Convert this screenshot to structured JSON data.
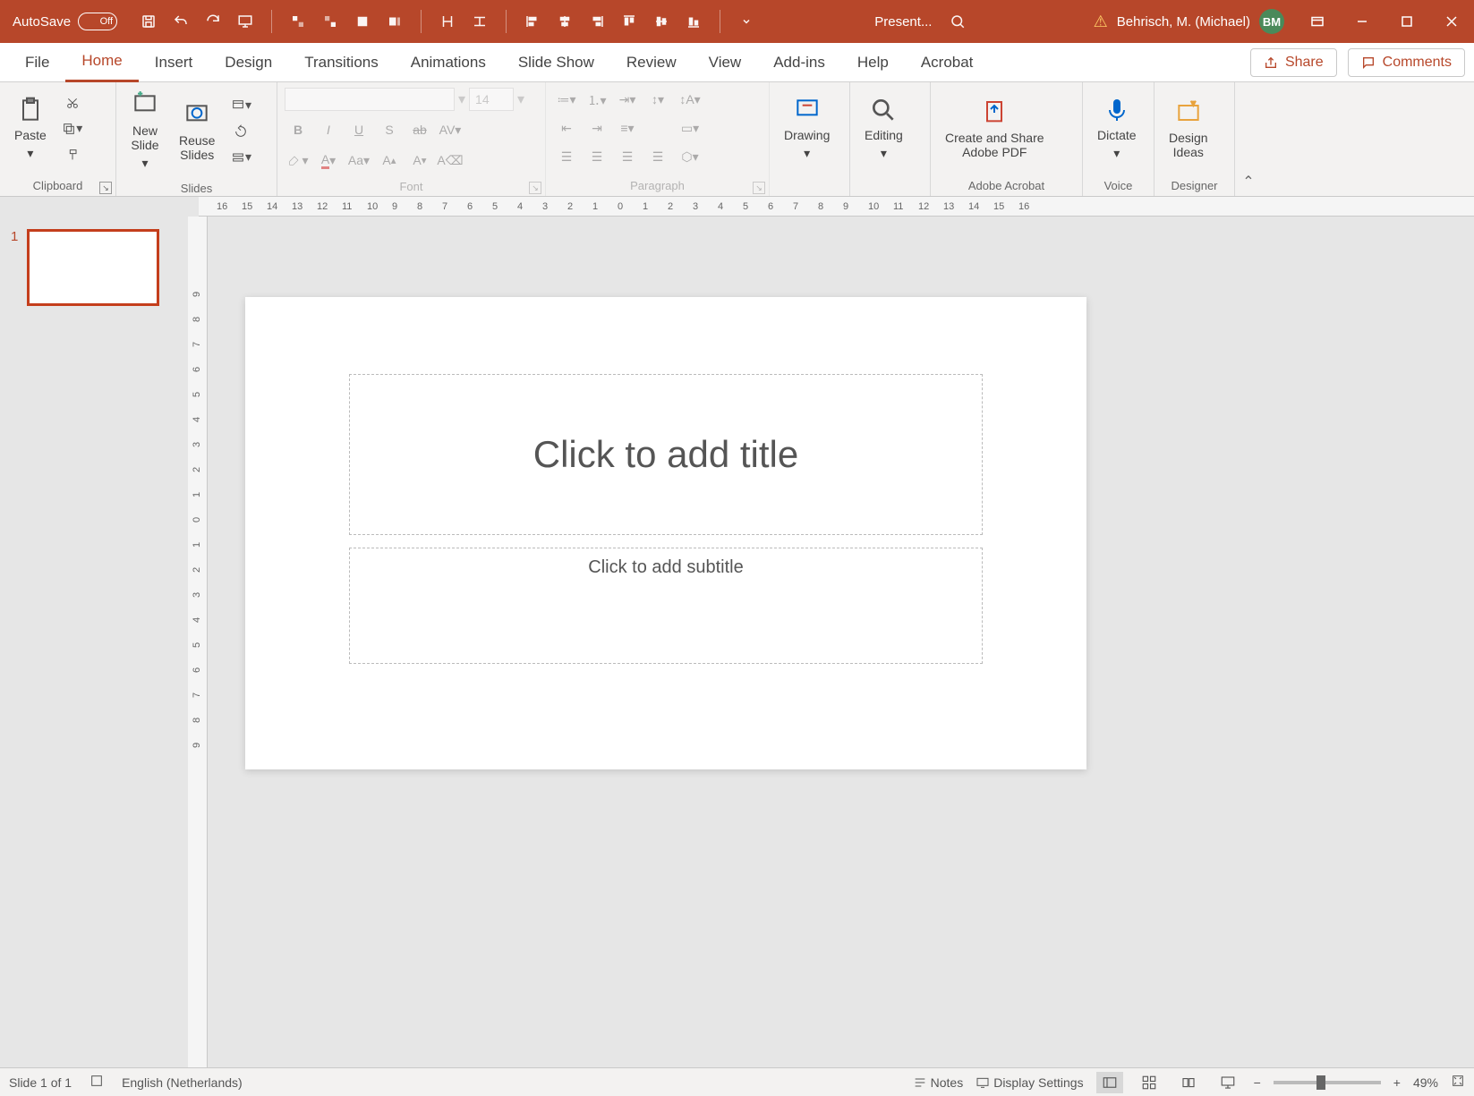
{
  "titlebar": {
    "autosave_label": "AutoSave",
    "autosave_state": "Off",
    "doc_title": "Present...",
    "user_name": "Behrisch, M. (Michael)",
    "user_initials": "BM"
  },
  "tabs": {
    "items": [
      "File",
      "Home",
      "Insert",
      "Design",
      "Transitions",
      "Animations",
      "Slide Show",
      "Review",
      "View",
      "Add-ins",
      "Help",
      "Acrobat"
    ],
    "active_index": 1,
    "share": "Share",
    "comments": "Comments"
  },
  "ribbon": {
    "clipboard": {
      "paste": "Paste",
      "label": "Clipboard"
    },
    "slides": {
      "new_slide": "New\nSlide",
      "reuse": "Reuse\nSlides",
      "label": "Slides"
    },
    "font": {
      "size": "14",
      "label": "Font"
    },
    "paragraph": {
      "label": "Paragraph"
    },
    "drawing": {
      "btn": "Drawing",
      "label": ""
    },
    "editing": {
      "btn": "Editing",
      "label": ""
    },
    "acrobat": {
      "btn": "Create and Share\nAdobe PDF",
      "label": "Adobe Acrobat"
    },
    "voice": {
      "btn": "Dictate",
      "label": "Voice"
    },
    "designer": {
      "btn": "Design\nIdeas",
      "label": "Designer"
    }
  },
  "ruler_h": [
    "16",
    "15",
    "14",
    "13",
    "12",
    "11",
    "10",
    "9",
    "8",
    "7",
    "6",
    "5",
    "4",
    "3",
    "2",
    "1",
    "0",
    "1",
    "2",
    "3",
    "4",
    "5",
    "6",
    "7",
    "8",
    "9",
    "10",
    "11",
    "12",
    "13",
    "14",
    "15",
    "16"
  ],
  "ruler_v": [
    "9",
    "8",
    "7",
    "6",
    "5",
    "4",
    "3",
    "2",
    "1",
    "0",
    "1",
    "2",
    "3",
    "4",
    "5",
    "6",
    "7",
    "8",
    "9"
  ],
  "thumbs": {
    "items": [
      {
        "num": "1"
      }
    ]
  },
  "slide": {
    "title_placeholder": "Click to add title",
    "subtitle_placeholder": "Click to add subtitle"
  },
  "statusbar": {
    "slide_info": "Slide 1 of 1",
    "language": "English (Netherlands)",
    "notes": "Notes",
    "display_settings": "Display Settings",
    "zoom": "49%"
  }
}
